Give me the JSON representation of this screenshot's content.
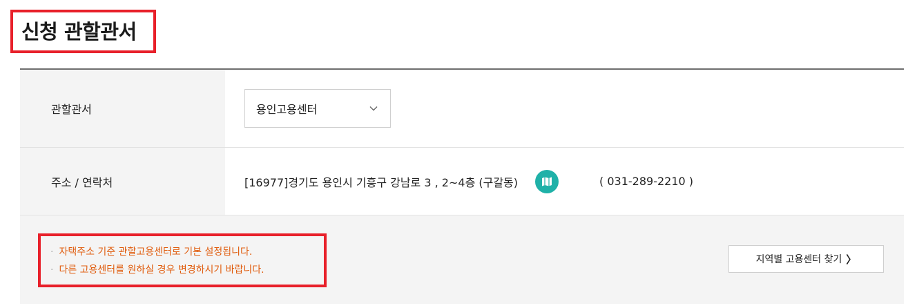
{
  "page": {
    "title": "신청 관할관서"
  },
  "form": {
    "office": {
      "label": "관할관서",
      "selected": "용인고용센터"
    },
    "contact": {
      "label": "주소 / 연락처",
      "address": "[16977]경기도 용인시 기흥구 강남로 3 , 2~4층 (구갈동)",
      "phone": "( 031-289-2210 )",
      "map_icon": "map-icon"
    }
  },
  "notes": {
    "lines": [
      "자택주소 기준 관할고용센터로 기본 설정됩니다.",
      "다른 고용센터를 원하실 경우 변경하시기 바랍니다."
    ],
    "bullet": "·",
    "find_button": "지역별 고용센터 찾기",
    "find_arrow": "〉"
  },
  "colors": {
    "highlight": "#e8202a",
    "note_text": "#e05b0c",
    "map_button": "#1fb1a8",
    "header_bg": "#f4f4f4"
  }
}
